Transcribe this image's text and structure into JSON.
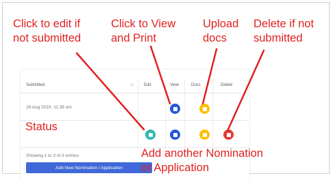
{
  "annotations": {
    "edit": [
      "Click to edit if",
      "not submitted"
    ],
    "view": [
      "Click to View",
      "and Print"
    ],
    "upload": [
      "Upload",
      "docs"
    ],
    "delete": [
      "Delete if not",
      "submitted"
    ],
    "status": "Status",
    "add": [
      "Add another Nomination",
      "or Application"
    ]
  },
  "table": {
    "headers": {
      "submitted": "Submitted",
      "sort": "↑↓",
      "edit": "Edit",
      "view": "View",
      "docs": "Docs",
      "delete": "Delete"
    },
    "row1_submitted": "28 Aug 2019, 11:39 am",
    "footer": "Showing 1 to 3 of 3 entries",
    "add_button": "Add New Nomination / Application"
  },
  "colors": {
    "annotation": "#e02020",
    "edit": "#2bbbad",
    "view": "#2557d6",
    "docs": "#ffbf00",
    "delete": "#e53935"
  }
}
